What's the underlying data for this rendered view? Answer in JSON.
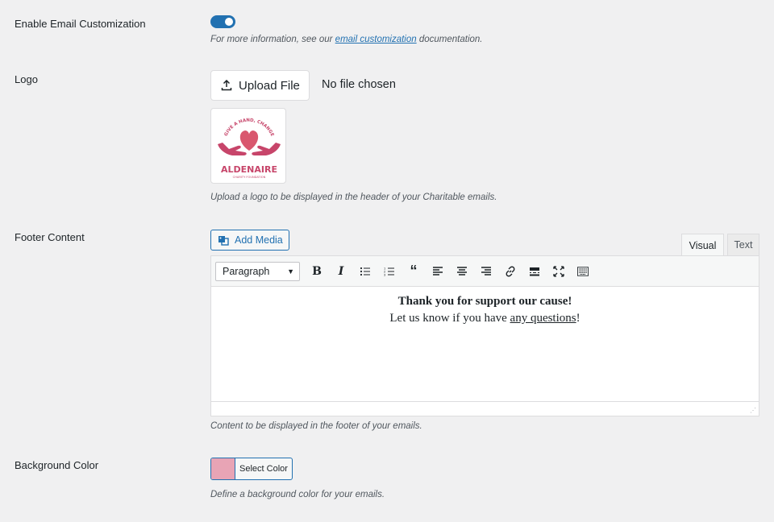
{
  "email_customization": {
    "label": "Enable Email Customization",
    "enabled": true,
    "desc_prefix": "For more information, see our ",
    "desc_link": "email customization",
    "desc_suffix": " documentation."
  },
  "logo": {
    "label": "Logo",
    "upload_label": "Upload File",
    "file_status": "No file chosen",
    "logo_brand": "ALDENAIRE",
    "logo_sub": "CHARITY FOUNDATION",
    "logo_arc": "GIVE A HAND, CHANGE A LIFE",
    "description": "Upload a logo to be displayed in the header of your Charitable emails."
  },
  "footer": {
    "label": "Footer Content",
    "add_media_label": "Add Media",
    "tabs": {
      "visual": "Visual",
      "text": "Text"
    },
    "format_value": "Paragraph",
    "content_line1": "Thank you for support our cause!",
    "content_line2_prefix": "Let us know if you have ",
    "content_line2_link": "any questions",
    "content_line2_suffix": "!",
    "description": "Content to be displayed in the footer of your emails."
  },
  "background_color": {
    "label": "Background Color",
    "button_label": "Select Color",
    "swatch_color": "#e8a4b5",
    "description": "Define a background color for your emails."
  },
  "colors": {
    "accent": "#2271b1",
    "logo_pink": "#c7456a",
    "logo_heart": "#d9576e"
  },
  "toolbar_icons": [
    "bold-icon",
    "italic-icon",
    "bullet-list-icon",
    "numbered-list-icon",
    "blockquote-icon",
    "align-left-icon",
    "align-center-icon",
    "align-right-icon",
    "link-icon",
    "read-more-icon",
    "fullscreen-icon",
    "toolbar-toggle-icon"
  ]
}
